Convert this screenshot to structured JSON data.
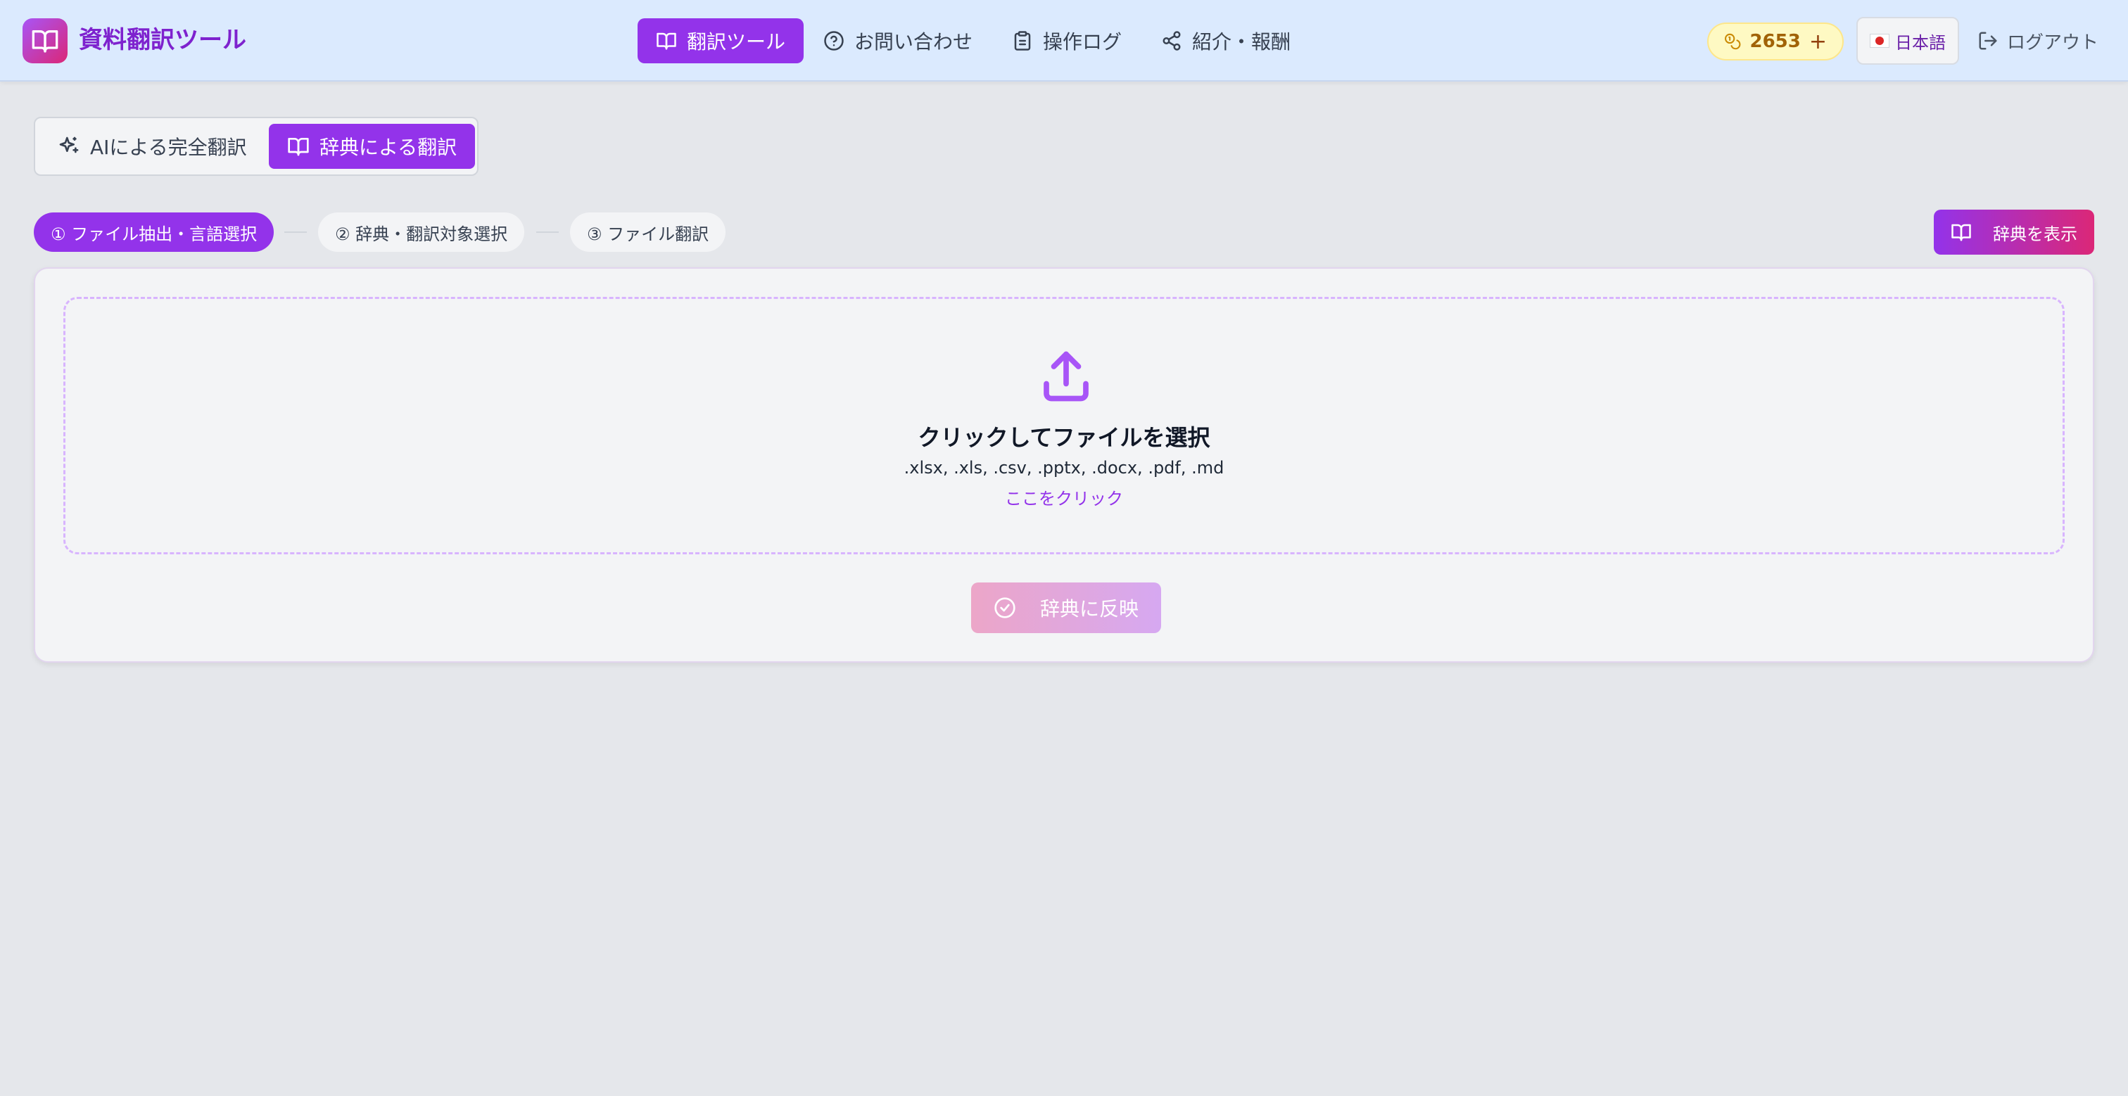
{
  "header": {
    "app_title": "資料翻訳ツール",
    "nav": [
      {
        "label": "翻訳ツール",
        "icon": "book-open-icon",
        "active": true
      },
      {
        "label": "お問い合わせ",
        "icon": "help-circle-icon",
        "active": false
      },
      {
        "label": "操作ログ",
        "icon": "clipboard-icon",
        "active": false
      },
      {
        "label": "紹介・報酬",
        "icon": "share-icon",
        "active": false
      }
    ],
    "credits": "2653",
    "credits_add": "+",
    "language": "日本語",
    "logout": "ログアウト"
  },
  "mode_toggle": {
    "ai_label": "AIによる完全翻訳",
    "dict_label": "辞典による翻訳",
    "selected": "dict"
  },
  "steps": [
    {
      "label": "① ファイル抽出・言語選択",
      "active": true
    },
    {
      "label": "② 辞典・翻訳対象選択",
      "active": false
    },
    {
      "label": "③ ファイル翻訳",
      "active": false
    }
  ],
  "show_dictionary_label": "辞典を表示",
  "upload": {
    "title": "クリックしてファイルを選択",
    "accepted_types": ".xlsx, .xls, .csv, .pptx, .docx, .pdf, .md",
    "click_here": "ここをクリック"
  },
  "apply_button_label": "辞典に反映",
  "colors": {
    "accent": "#9333ea",
    "gradient_pink": "#db2777",
    "header_bg": "#dbeafe",
    "page_bg": "#e5e7eb"
  }
}
